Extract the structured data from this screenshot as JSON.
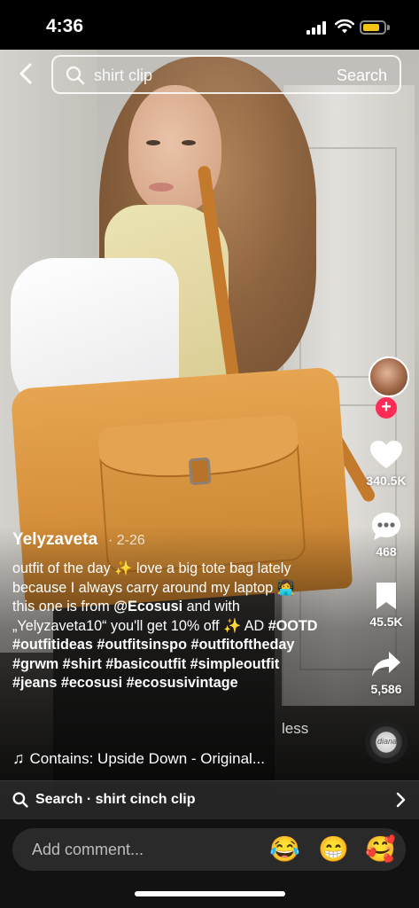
{
  "status_bar": {
    "time": "4:36"
  },
  "search": {
    "query": "shirt clip",
    "submit_label": "Search"
  },
  "post": {
    "author": "Yelyzaveta",
    "date": "· 2-26",
    "caption_line1": "outfit of the day ✨ love a big tote bag lately because I always carry around my laptop 👩‍💻 this one is from ",
    "mention": "@Ecosusi",
    "caption_line2": " and with „Yelyzaveta10“ you'll get 10% off ✨ AD ",
    "hashtags": "#OOTD #outfitideas #outfitsinspo #outfitoftheday #grwm #shirt #basicoutfit #simpleoutfit #jeans #ecosusi #ecosusivintage",
    "less_label": "less",
    "music": "Contains: Upside Down - Original..."
  },
  "rail": {
    "follow_label": "+",
    "likes": "340.5K",
    "comments": "468",
    "saves": "45.5K",
    "shares": "5,586",
    "disc_label": "diana"
  },
  "suggestion": {
    "text": "Search · shirt cinch clip"
  },
  "comment_bar": {
    "placeholder": "Add comment...",
    "emojis": [
      "😂",
      "😁",
      "🥰"
    ]
  },
  "colors": {
    "accent": "#fe2c55",
    "battery": "#f3c515",
    "bag": "#d8923d"
  }
}
